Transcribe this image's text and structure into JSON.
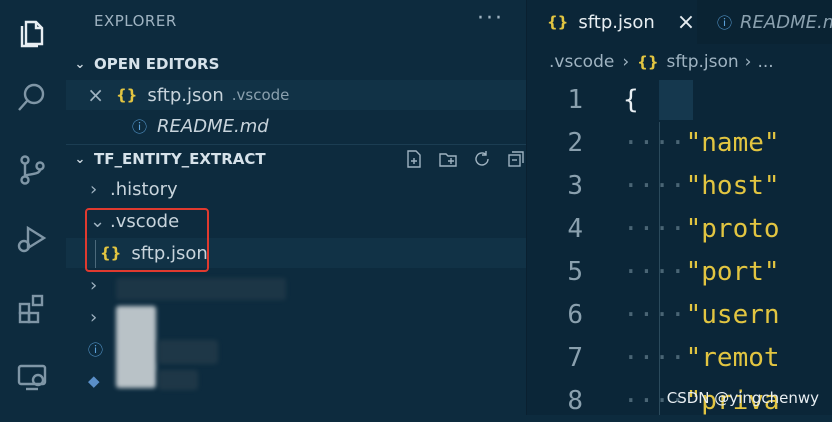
{
  "sidebar": {
    "header": "EXPLORER",
    "more": "···",
    "open_editors": {
      "title": "OPEN EDITORS",
      "items": [
        {
          "close": "×",
          "icon": "{}",
          "name": "sftp.json",
          "path": ".vscode"
        },
        {
          "icon": "ⓘ",
          "name": "README.md"
        }
      ]
    },
    "project": {
      "title": "TF_ENTITY_EXTRACT",
      "items": [
        {
          "chevron": "›",
          "name": ".history"
        },
        {
          "chevron": "⌄",
          "name": ".vscode"
        },
        {
          "icon": "{}",
          "name": "sftp.json"
        }
      ]
    }
  },
  "editor": {
    "tabs": [
      {
        "icon": "{}",
        "label": "sftp.json",
        "close": "×"
      },
      {
        "icon": "ⓘ",
        "label": "README.m"
      }
    ],
    "breadcrumb": {
      "folder": ".vscode",
      "sep": "›",
      "icon": "{}",
      "file": "sftp.json",
      "sep2": "›",
      "more": "..."
    },
    "lines": [
      {
        "n": "1",
        "dots": "",
        "text": "{"
      },
      {
        "n": "2",
        "dots": "····",
        "text": "\"name\""
      },
      {
        "n": "3",
        "dots": "····",
        "text": "\"host\""
      },
      {
        "n": "4",
        "dots": "····",
        "text": "\"proto"
      },
      {
        "n": "5",
        "dots": "····",
        "text": "\"port\""
      },
      {
        "n": "6",
        "dots": "····",
        "text": "\"usern"
      },
      {
        "n": "7",
        "dots": "····",
        "text": "\"remot"
      },
      {
        "n": "8",
        "dots": "····",
        "text": "\"priva"
      }
    ]
  },
  "watermark": "CSDN @yingchenwy"
}
